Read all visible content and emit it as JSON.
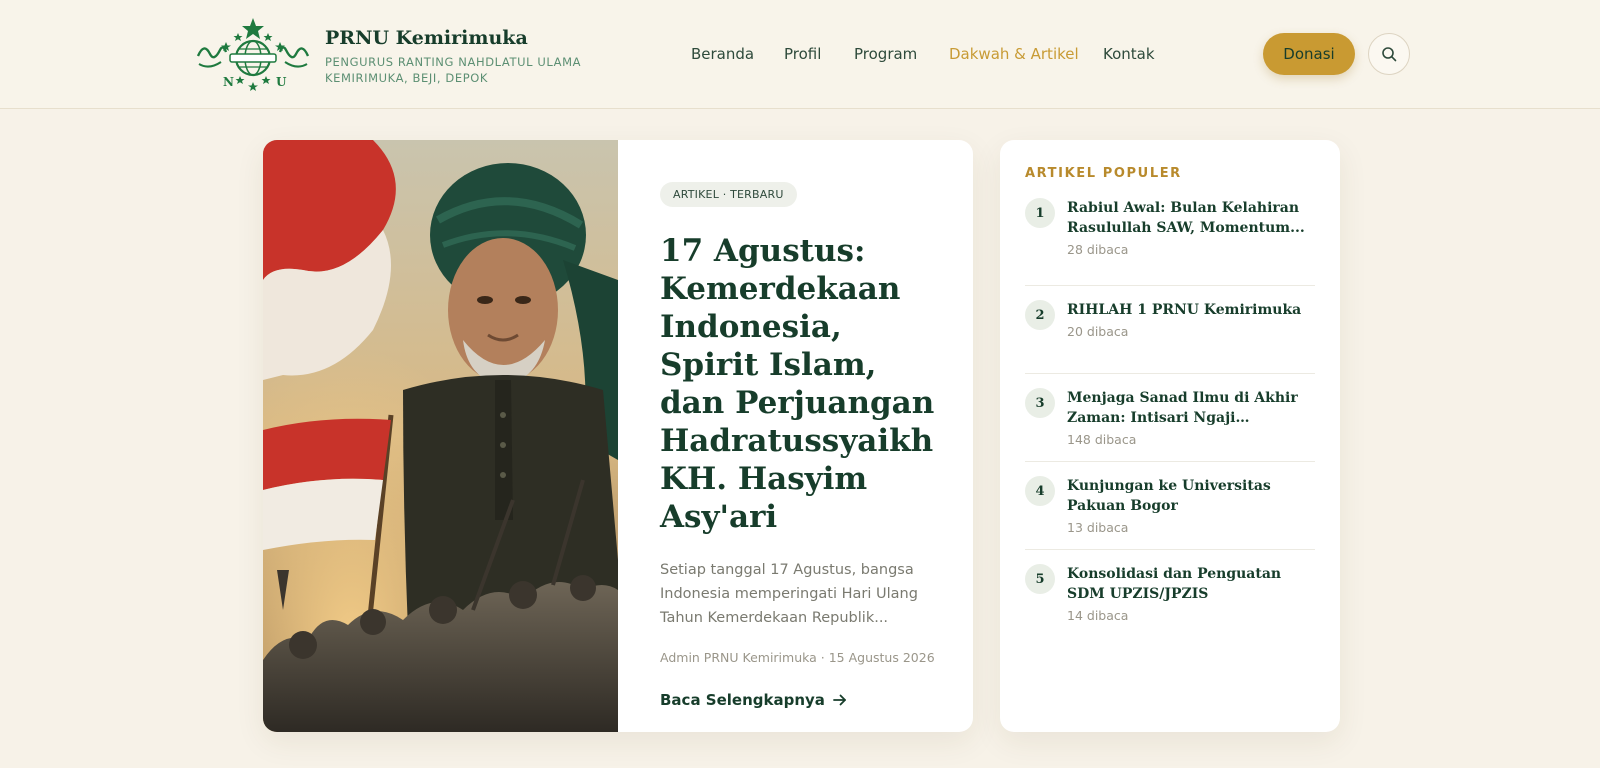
{
  "brand": {
    "title": "PRNU Kemirimuka",
    "subtitle_line1": "PENGURUS RANTING NAHDLATUL ULAMA",
    "subtitle_line2": "KEMIRIMUKA, BEJI, DEPOK",
    "logo_icon": "nu-globe-logo",
    "logo_letters": [
      "N",
      "U"
    ]
  },
  "nav": [
    {
      "label": "Beranda",
      "active": false
    },
    {
      "label": "Profil",
      "active": false
    },
    {
      "label": "Program",
      "active": false
    },
    {
      "label": "Dakwah & Artikel",
      "active": true
    },
    {
      "label": "Kontak",
      "active": false
    }
  ],
  "actions": {
    "donate_label": "Donasi",
    "search_icon": "search-icon"
  },
  "featured": {
    "tag": "ARTIKEL · TERBARU",
    "title": "17 Agustus: Kemerdekaan Indonesia, Spirit Islam, dan Perjuangan Hadratussyaikh KH. Hasyim Asy'ari",
    "excerpt": "Setiap tanggal 17 Agustus, bangsa Indonesia memperingati Hari Ulang Tahun Kemerdekaan Republik...",
    "meta": "Admin PRNU Kemirimuka · 15 Agustus 2026",
    "read_more": "Baca Selengkapnya",
    "image_icon": "featured-article-image"
  },
  "popular": {
    "heading": "ARTIKEL POPULER",
    "items": [
      {
        "num": "1",
        "title": "Rabiul Awal: Bulan Kelahiran Rasulullah SAW, Momentum...",
        "reads": "28 dibaca"
      },
      {
        "num": "2",
        "title": "RIHLAH 1 PRNU Kemirimuka",
        "reads": "20 dibaca"
      },
      {
        "num": "3",
        "title": "Menjaga Sanad Ilmu di Akhir Zaman: Intisari Ngaji \"Sarungan\"...",
        "reads": "148 dibaca"
      },
      {
        "num": "4",
        "title": "Kunjungan ke Universitas Pakuan Bogor",
        "reads": "13 dibaca"
      },
      {
        "num": "5",
        "title": "Konsolidasi dan Penguatan SDM UPZIS/JPZIS",
        "reads": "14 dibaca"
      }
    ]
  },
  "colors": {
    "primary": "#173d2b",
    "accent": "#c99a32",
    "background": "#f7f2e8",
    "logo_green": "#1f7a3f"
  }
}
